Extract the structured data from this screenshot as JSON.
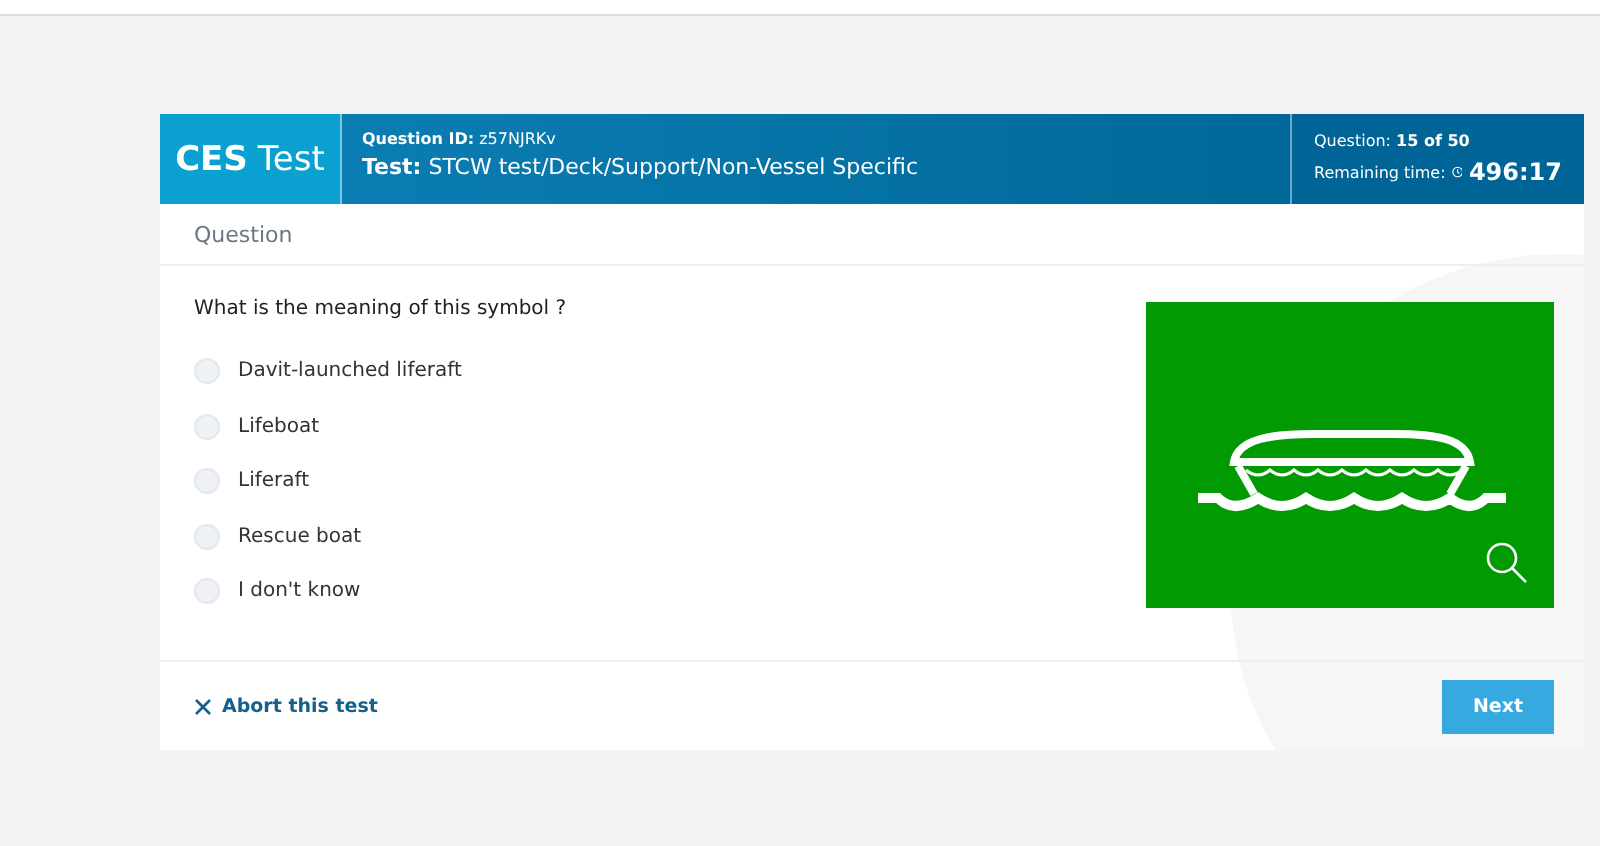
{
  "header": {
    "logo_bold": "CES",
    "logo_light": "Test",
    "question_id_label": "Question ID:",
    "question_id": "z57NJRKv",
    "test_label": "Test:",
    "test": "STCW test/Deck/Support/Non-Vessel Specific",
    "progress_label": "Question:",
    "progress": "15 of 50",
    "time_label": "Remaining time:",
    "time": "496:17"
  },
  "section_title": "Question",
  "question": "What is the meaning of this symbol ?",
  "options": [
    {
      "label": "Davit-launched liferaft",
      "selected": false
    },
    {
      "label": "Lifeboat",
      "selected": false
    },
    {
      "label": "Liferaft",
      "selected": false
    },
    {
      "label": "Rescue boat",
      "selected": false
    },
    {
      "label": "I don't know",
      "selected": false
    }
  ],
  "footer": {
    "abort": "Abort this test",
    "next": "Next"
  }
}
